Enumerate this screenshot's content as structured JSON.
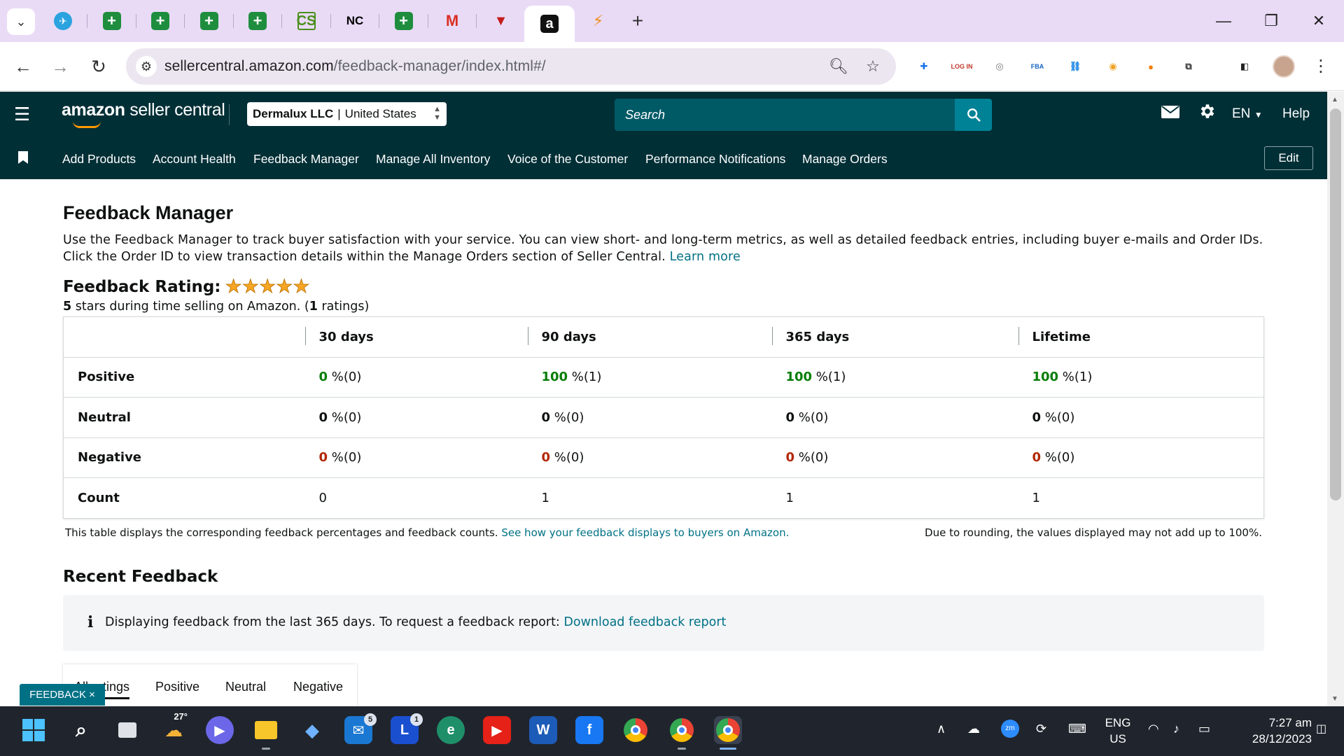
{
  "browser": {
    "tab_list_glyph": "⌄",
    "tabs": [
      {
        "icon": "telegram-icon",
        "glyph": "✈"
      },
      {
        "icon": "sheets-icon",
        "glyph": "+"
      },
      {
        "icon": "sheets-icon",
        "glyph": "+"
      },
      {
        "icon": "sheets-icon",
        "glyph": "+"
      },
      {
        "icon": "sheets-icon",
        "glyph": "+"
      },
      {
        "icon": "cs-icon",
        "glyph": "CS"
      },
      {
        "icon": "nc-icon",
        "glyph": "NC"
      },
      {
        "icon": "sheets-icon",
        "glyph": "+"
      },
      {
        "icon": "gmail-icon",
        "glyph": "M"
      },
      {
        "icon": "vv-icon",
        "glyph": "▼"
      },
      {
        "icon": "amazon-icon",
        "glyph": "a"
      },
      {
        "icon": "zz-icon",
        "glyph": "⚡"
      }
    ],
    "new_tab_glyph": "+",
    "window_controls": {
      "minimize": "—",
      "restore": "❐",
      "close": "✕"
    },
    "nav": {
      "back": "←",
      "forward": "→",
      "reload": "↻"
    },
    "url_host": "sellercentral.amazon.com",
    "url_path": "/feedback-manager/index.html#/",
    "extensions": [
      {
        "name": "ext-blue-icon",
        "glyph": "✚",
        "color": "#1a73e8"
      },
      {
        "name": "ext-login-icon",
        "glyph": "LOG IN",
        "color": "#c0392b"
      },
      {
        "name": "ext-lens-icon",
        "glyph": "◎",
        "color": "#777777"
      },
      {
        "name": "ext-fba-icon",
        "glyph": "FBA",
        "color": "#1565c0"
      },
      {
        "name": "ext-link-icon",
        "glyph": "⛓",
        "color": "#1e88e5"
      },
      {
        "name": "ext-cake-icon",
        "glyph": "◉",
        "color": "#f0a020"
      },
      {
        "name": "ext-orange-icon",
        "glyph": "●",
        "color": "#f57c00"
      },
      {
        "name": "extensions-puzzle-icon",
        "glyph": "⧉",
        "color": "#333333"
      },
      {
        "name": "side-panel-icon",
        "glyph": "◧",
        "color": "#222222"
      }
    ],
    "menu_glyph": "⋮"
  },
  "header": {
    "logo_brand": "amazon",
    "logo_product": "seller central",
    "merchant": "Dermalux LLC",
    "marketplace": "United States",
    "search_placeholder": "Search",
    "language": "EN",
    "help": "Help"
  },
  "nav_items": [
    "Add Products",
    "Account Health",
    "Feedback Manager",
    "Manage All Inventory",
    "Voice of the Customer",
    "Performance Notifications",
    "Manage Orders"
  ],
  "nav_edit": "Edit",
  "page": {
    "title": "Feedback Manager",
    "intro_1": "Use the Feedback Manager to track buyer satisfaction with your service. You can view short- and long-term metrics, as well as detailed feedback entries, including buyer e-mails and Order IDs. Click the Order ID to view transaction details within the Manage Orders section of Seller Central.",
    "learn_more": "Learn more",
    "rating_label": "Feedback Rating:",
    "stars_value": 5,
    "stars_max": 5,
    "rating_sub_value": "5",
    "rating_sub_text": " stars during time selling on Amazon. (",
    "rating_sub_count": "1",
    "rating_sub_tail": " ratings)"
  },
  "feedback_table": {
    "columns": [
      "30 days",
      "90 days",
      "365 days",
      "Lifetime"
    ],
    "rows": [
      {
        "label": "Positive",
        "type": "pos",
        "cells": [
          [
            "0",
            " %(0)"
          ],
          [
            "100",
            " %(1)"
          ],
          [
            "100",
            " %(1)"
          ],
          [
            "100",
            " %(1)"
          ]
        ]
      },
      {
        "label": "Neutral",
        "type": "neu",
        "cells": [
          [
            "0",
            " %(0)"
          ],
          [
            "0",
            " %(0)"
          ],
          [
            "0",
            " %(0)"
          ],
          [
            "0",
            " %(0)"
          ]
        ]
      },
      {
        "label": "Negative",
        "type": "neg",
        "cells": [
          [
            "0",
            " %(0)"
          ],
          [
            "0",
            " %(0)"
          ],
          [
            "0",
            " %(0)"
          ],
          [
            "0",
            " %(0)"
          ]
        ]
      },
      {
        "label": "Count",
        "type": "count",
        "cells": [
          [
            "",
            "0"
          ],
          [
            "",
            "1"
          ],
          [
            "",
            "1"
          ],
          [
            "",
            "1"
          ]
        ]
      }
    ],
    "note": "This table displays the corresponding feedback percentages and feedback counts.",
    "note_link": "See how your feedback displays to buyers on Amazon.",
    "note_right": "Due to rounding, the values displayed may not add up to 100%."
  },
  "recent": {
    "title": "Recent Feedback",
    "info_text": "Displaying feedback from the last 365 days. To request a feedback report:",
    "info_link": "Download feedback report",
    "tabs": [
      "All ratings",
      "Positive",
      "Neutral",
      "Negative"
    ]
  },
  "feedback_button": "FEEDBACK ×",
  "taskbar": {
    "weather_temp": "27°",
    "mail_badge": "5",
    "l_badge": "1",
    "lang_line1": "ENG",
    "lang_line2": "US",
    "time": "7:27 am",
    "date": "28/12/2023"
  },
  "colors": {
    "header_bg": "#002f36",
    "search_bg": "#005a66",
    "search_btn": "#008296",
    "link": "#007185",
    "positive": "#067d06",
    "negative": "#b12704",
    "star": "#f6a623",
    "tabstrip": "#e9dbf6"
  }
}
